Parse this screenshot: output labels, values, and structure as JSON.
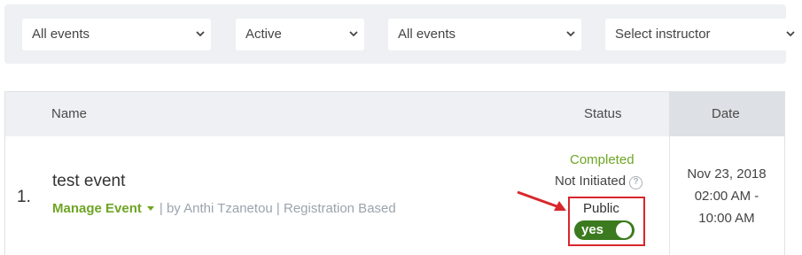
{
  "filters": [
    {
      "value": "All events"
    },
    {
      "value": "Active"
    },
    {
      "value": "All events"
    },
    {
      "value": "Select instructor"
    }
  ],
  "table": {
    "headers": {
      "name": "Name",
      "status": "Status",
      "date": "Date"
    },
    "rows": [
      {
        "number": "1.",
        "title": "test event",
        "manage_label": "Manage Event",
        "meta": "| by Anthi Tzanetou | Registration Based",
        "status_completed": "Completed",
        "status_initiated": "Not Initiated",
        "visibility_label": "Public",
        "toggle_label": "yes",
        "date_line1": "Nov 23, 2018",
        "date_line2": "02:00 AM -",
        "date_line3": "10:00 AM"
      }
    ]
  },
  "colors": {
    "accent_green": "#6ea524",
    "toggle_green": "#3b7a1e",
    "highlight_red": "#d9262c"
  },
  "icons": [
    "chevron-down-icon",
    "caret-down-icon",
    "help-icon",
    "annotation-arrow-icon"
  ]
}
